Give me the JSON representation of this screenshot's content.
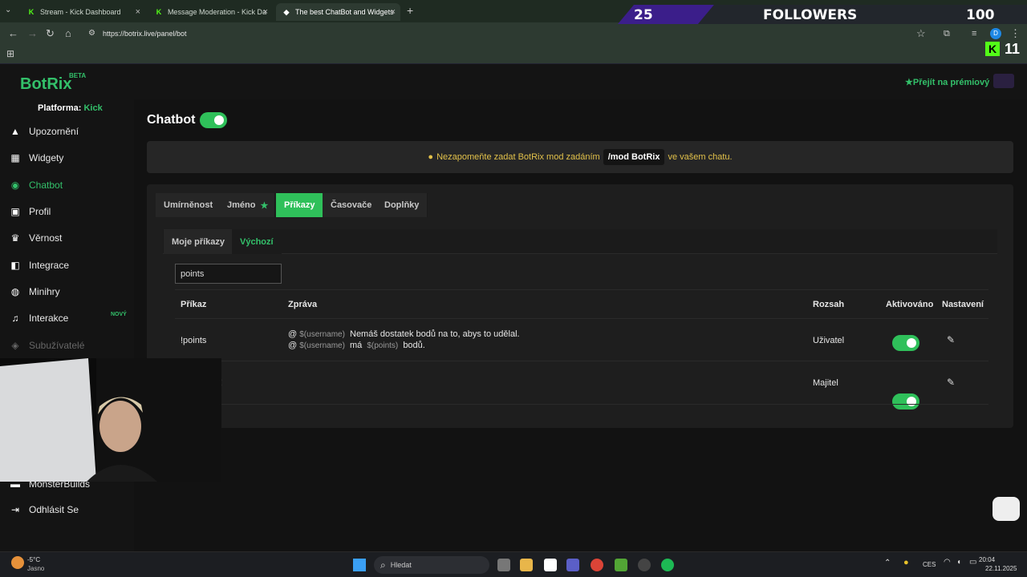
{
  "browser": {
    "tabs": [
      {
        "title": "Stream - Kick Dashboard",
        "icon": "kick-icon"
      },
      {
        "title": "Message Moderation - Kick Da",
        "icon": "kick-icon"
      },
      {
        "title": "The best ChatBot and Widgets",
        "icon": "botrix-icon"
      }
    ],
    "url": "https://botrix.live/panel/bot",
    "profile_letter": "D"
  },
  "overlay": {
    "left_count": "25",
    "followers_label": "FOLLOWERS",
    "right_count": "100",
    "viewers": "11"
  },
  "app": {
    "logo": "BotRix",
    "logo_badge": "BETA",
    "platform_label": "Platforma:",
    "platform_value": "Kick",
    "premium": "Přejít na prémiový"
  },
  "sidebar": {
    "items": [
      {
        "label": "Upozornění",
        "icon": "warning-icon"
      },
      {
        "label": "Widgety",
        "icon": "widgets-icon"
      },
      {
        "label": "Chatbot",
        "icon": "robot-icon"
      },
      {
        "label": "Profil",
        "icon": "profile-icon"
      },
      {
        "label": "Věrnost",
        "icon": "trophy-icon"
      },
      {
        "label": "Integrace",
        "icon": "integration-icon"
      },
      {
        "label": "Minihry",
        "icon": "gamepad-icon"
      },
      {
        "label": "Interakce",
        "icon": "music-icon",
        "badge": "NOVÝ"
      },
      {
        "label": "Subužívatelé",
        "icon": "users-icon"
      },
      {
        "label": "MonsterBuilds",
        "icon": "server-icon"
      },
      {
        "label": "Odhlásit Se",
        "icon": "logout-icon"
      }
    ]
  },
  "page": {
    "title": "Chatbot",
    "notice_pre": "Nezapomeňte zadat BotRix mod zadáním",
    "notice_code": "/mod BotRix",
    "notice_post": "ve vašem chatu."
  },
  "tabs": [
    "Umírněnost",
    "Jméno",
    "Příkazy",
    "Časovače",
    "Doplňky"
  ],
  "subtabs": [
    "Moje příkazy",
    "Výchozí"
  ],
  "search": {
    "value": "points"
  },
  "table": {
    "headers": [
      "Příkaz",
      "Zpráva",
      "Rozsah",
      "Aktivováno",
      "Nastavení"
    ],
    "rows": [
      {
        "command": "!points",
        "line1_var": "$(username)",
        "line1_text": "Nemáš dostatek bodů na to, abys to udělal.",
        "line2_var": "$(username)",
        "line2_mid": "má",
        "line2_var2": "$(points)",
        "line2_text": "bodů.",
        "scope": "Uživatel",
        "enabled": true
      },
      {
        "command": "!",
        "scope": "Majitel",
        "enabled": true
      }
    ]
  },
  "taskbar": {
    "weather_temp": "-5°C",
    "weather_text": "Jasno",
    "search_placeholder": "Hledat",
    "lang": "CES",
    "time": "20:04",
    "date": "22.11.2025"
  },
  "colors": {
    "accent": "#2fc05a",
    "notice": "#e2c14a"
  }
}
